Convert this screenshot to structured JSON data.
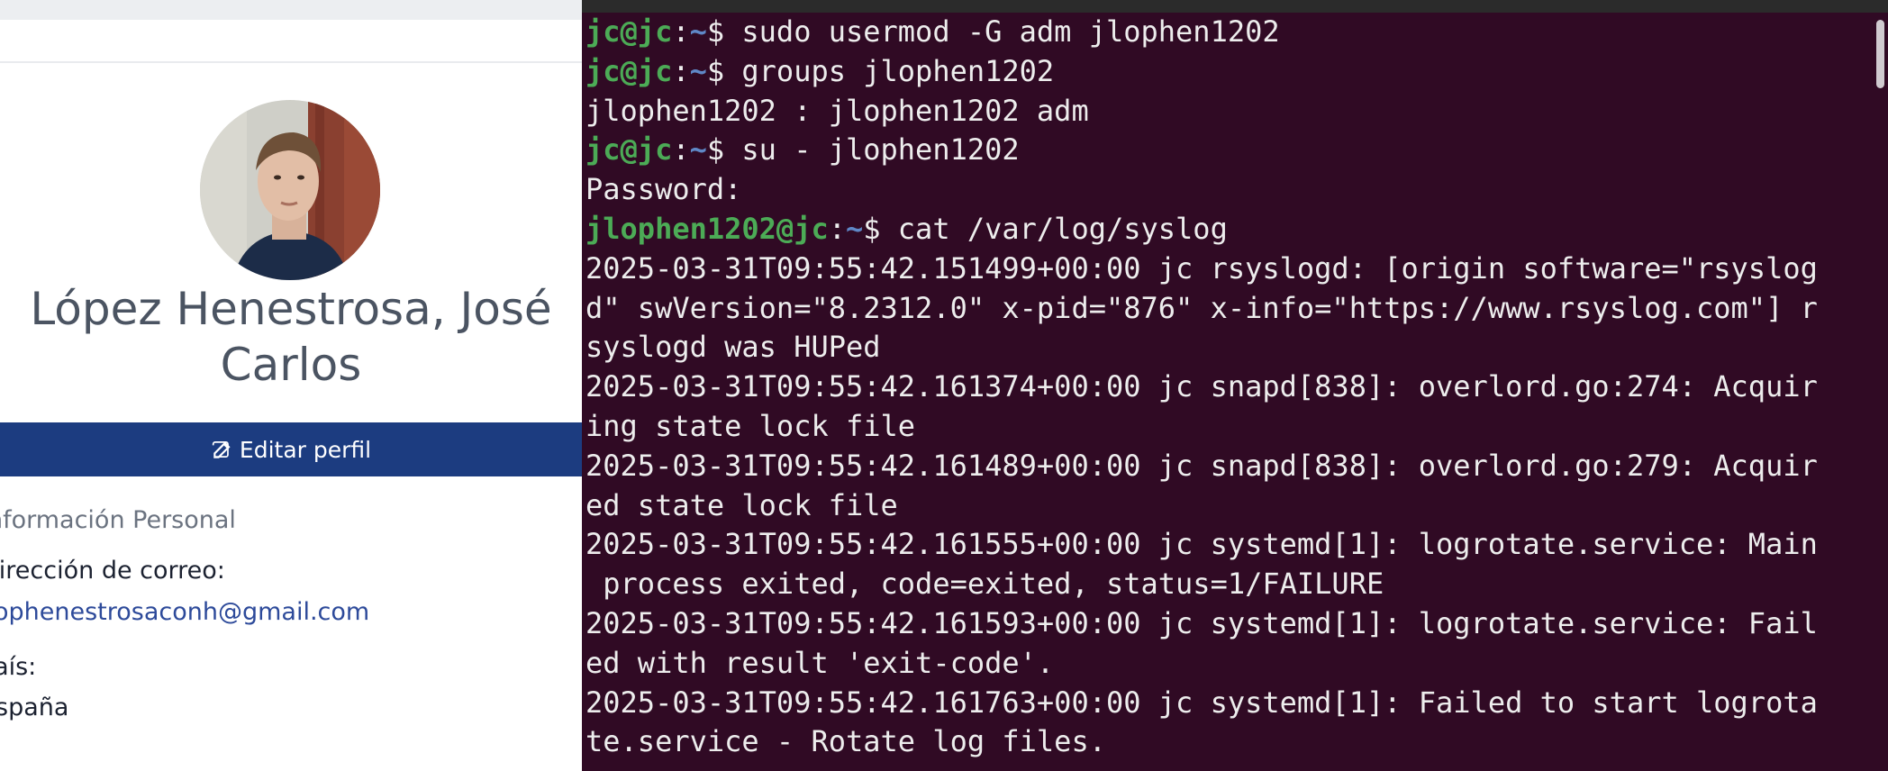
{
  "profile": {
    "name": "López Henestrosa, José Carlos",
    "edit_button": "Editar perfil",
    "section_title": "Información Personal",
    "email_label": "Dirección de correo:",
    "email": "jlophenestrosaconh@gmail.com",
    "country_label": "País:",
    "country": "España"
  },
  "terminal": {
    "colors": {
      "background": "#300a24",
      "prompt_user": "#4cab56",
      "prompt_path": "#5f88c7",
      "text": "#ededed"
    },
    "lines": [
      {
        "user": "jc@jc",
        "path": "~",
        "cmd": "sudo usermod -G adm jlophen1202"
      },
      {
        "user": "jc@jc",
        "path": "~",
        "cmd": "groups jlophen1202"
      },
      {
        "text": "jlophen1202 : jlophen1202 adm"
      },
      {
        "user": "jc@jc",
        "path": "~",
        "cmd": "su - jlophen1202"
      },
      {
        "text": "Password:"
      },
      {
        "user": "jlophen1202@jc",
        "path": "~",
        "cmd": "cat /var/log/syslog"
      },
      {
        "text": "2025-03-31T09:55:42.151499+00:00 jc rsyslogd: [origin software=\"rsyslog"
      },
      {
        "text": "d\" swVersion=\"8.2312.0\" x-pid=\"876\" x-info=\"https://www.rsyslog.com\"] r"
      },
      {
        "text": "syslogd was HUPed"
      },
      {
        "text": "2025-03-31T09:55:42.161374+00:00 jc snapd[838]: overlord.go:274: Acquir"
      },
      {
        "text": "ing state lock file"
      },
      {
        "text": "2025-03-31T09:55:42.161489+00:00 jc snapd[838]: overlord.go:279: Acquir"
      },
      {
        "text": "ed state lock file"
      },
      {
        "text": "2025-03-31T09:55:42.161555+00:00 jc systemd[1]: logrotate.service: Main"
      },
      {
        "text": " process exited, code=exited, status=1/FAILURE"
      },
      {
        "text": "2025-03-31T09:55:42.161593+00:00 jc systemd[1]: logrotate.service: Fail"
      },
      {
        "text": "ed with result 'exit-code'."
      },
      {
        "text": "2025-03-31T09:55:42.161763+00:00 jc systemd[1]: Failed to start logrota"
      },
      {
        "text": "te.service - Rotate log files."
      }
    ]
  }
}
